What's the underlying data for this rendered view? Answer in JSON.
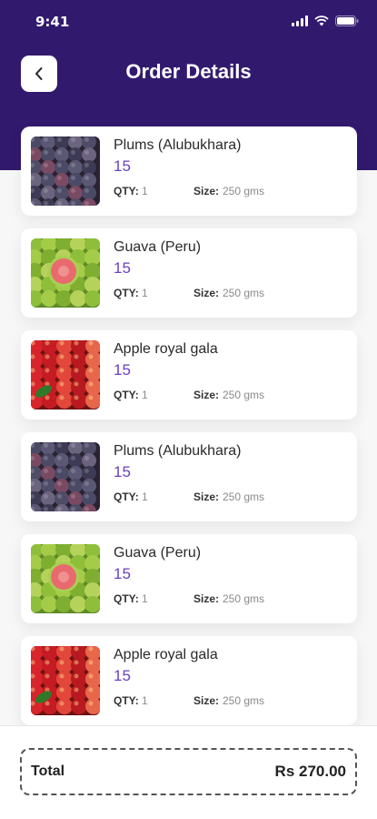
{
  "status_bar": {
    "time": "9:41"
  },
  "header": {
    "title": "Order Details"
  },
  "colors": {
    "header_bg": "#311a6e",
    "price": "#6a3fbf"
  },
  "items": [
    {
      "name": "Plums (Alubukhara)",
      "price": "15",
      "qty_label": "QTY:",
      "qty": "1",
      "size_label": "Size:",
      "size": "250 gms",
      "image": "plums"
    },
    {
      "name": "Guava (Peru)",
      "price": "15",
      "qty_label": "QTY:",
      "qty": "1",
      "size_label": "Size:",
      "size": "250 gms",
      "image": "guava"
    },
    {
      "name": "Apple royal gala",
      "price": "15",
      "qty_label": "QTY:",
      "qty": "1",
      "size_label": "Size:",
      "size": "250 gms",
      "image": "apple"
    },
    {
      "name": "Plums (Alubukhara)",
      "price": "15",
      "qty_label": "QTY:",
      "qty": "1",
      "size_label": "Size:",
      "size": "250 gms",
      "image": "plums"
    },
    {
      "name": "Guava (Peru)",
      "price": "15",
      "qty_label": "QTY:",
      "qty": "1",
      "size_label": "Size:",
      "size": "250 gms",
      "image": "guava"
    },
    {
      "name": "Apple royal gala",
      "price": "15",
      "qty_label": "QTY:",
      "qty": "1",
      "size_label": "Size:",
      "size": "250 gms",
      "image": "apple"
    }
  ],
  "footer": {
    "total_label": "Total",
    "total_value": "Rs 270.00"
  }
}
